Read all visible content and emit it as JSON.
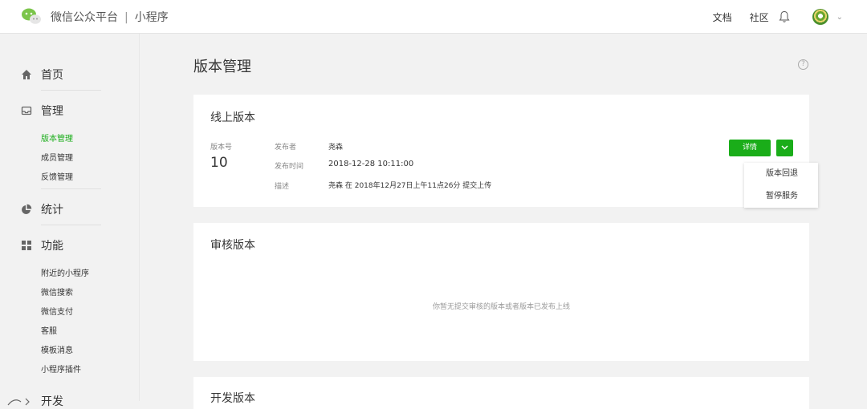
{
  "header": {
    "brand": "微信公众平台",
    "separator": "|",
    "product": "小程序",
    "links": [
      "文档",
      "社区"
    ]
  },
  "sidebar": {
    "sections": [
      {
        "label": "首页",
        "icon": "home-icon"
      },
      {
        "label": "管理",
        "icon": "inbox-icon",
        "items": [
          "版本管理",
          "成员管理",
          "反馈管理"
        ],
        "active": "版本管理"
      },
      {
        "label": "统计",
        "icon": "pie-chart-icon"
      },
      {
        "label": "功能",
        "icon": "grid-icon",
        "items": [
          "附近的小程序",
          "微信搜索",
          "微信支付",
          "客服",
          "模板消息",
          "小程序插件"
        ]
      },
      {
        "label": "开发",
        "icon": "develop-icon"
      }
    ]
  },
  "page": {
    "title": "版本管理",
    "help": "?"
  },
  "online": {
    "title": "线上版本",
    "version_label": "版本号",
    "version_value": "10",
    "publisher_key": "发布者",
    "publisher_val": "尧森",
    "time_key": "发布时间",
    "time_val": "2018-12-28 10:11:00",
    "desc_key": "描述",
    "desc_val": "尧森 在 2018年12月27日上午11点26分 提交上传",
    "detail_button": "详情",
    "menu": [
      "版本回退",
      "暂停服务"
    ]
  },
  "review": {
    "title": "审核版本",
    "empty": "你暂无提交审核的版本或者版本已发布上线"
  },
  "dev": {
    "title": "开发版本"
  },
  "colors": {
    "accent": "#1aad19",
    "background": "#f2f2f2"
  }
}
